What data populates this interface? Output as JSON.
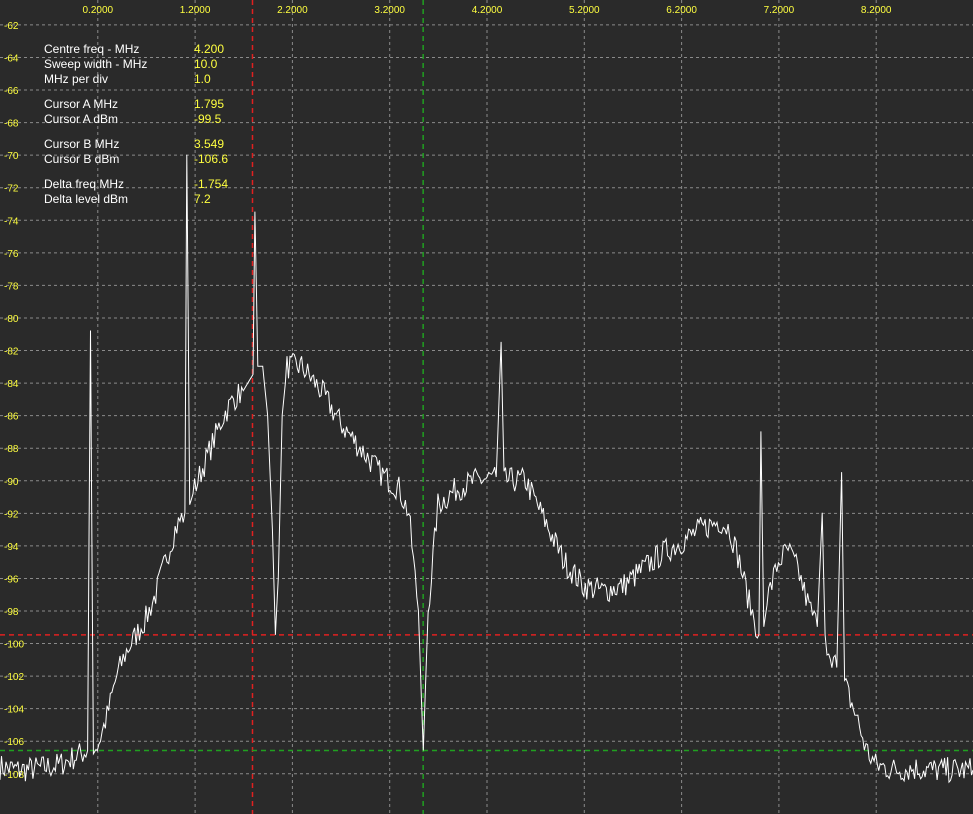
{
  "chart_data": {
    "type": "line",
    "title": "",
    "xlabel": "",
    "ylabel": "",
    "x_tick_labels": [
      "0.2000",
      "1.2000",
      "2.2000",
      "3.2000",
      "4.2000",
      "5.2000",
      "6.2000",
      "7.2000",
      "8.2000"
    ],
    "x_ticks": [
      0.2,
      1.2,
      2.2,
      3.2,
      4.2,
      5.2,
      6.2,
      7.2,
      8.2
    ],
    "xlim": [
      -0.8,
      9.2
    ],
    "y_tick_labels": [
      "-62",
      "-64",
      "-66",
      "-68",
      "-70",
      "-72",
      "-74",
      "-76",
      "-78",
      "-80",
      "-82",
      "-84",
      "-86",
      "-88",
      "-90",
      "-92",
      "-94",
      "-96",
      "-98",
      "-100",
      "-102",
      "-104",
      "-106",
      "-108"
    ],
    "y_ticks": [
      -62,
      -64,
      -66,
      -68,
      -70,
      -72,
      -74,
      -76,
      -78,
      -80,
      -82,
      -84,
      -86,
      -88,
      -90,
      -92,
      -94,
      -96,
      -98,
      -100,
      -102,
      -104,
      -106,
      -108
    ],
    "ylim": [
      -110.5,
      -60.5
    ],
    "grid": true,
    "colors": {
      "background": "#2a2a2a",
      "grid": "#8a8a8a",
      "trace": "#ffffff",
      "labels": "#ffff40",
      "cursor_a": "#e02020",
      "cursor_b": "#20a020"
    },
    "cursors": {
      "a": {
        "freq": 1.795,
        "level": -99.5
      },
      "b": {
        "freq": 3.549,
        "level": -106.6
      }
    },
    "series": [
      {
        "values": [
          [
            -0.8,
            -107.6
          ],
          [
            -0.6,
            -107.8
          ],
          [
            -0.4,
            -107.7
          ],
          [
            -0.2,
            -107.5
          ],
          [
            0.0,
            -106.9
          ],
          [
            0.1,
            -106.6
          ],
          [
            0.13,
            -80.8
          ],
          [
            0.16,
            -106.8
          ],
          [
            0.2,
            -106.4
          ],
          [
            0.3,
            -104.5
          ],
          [
            0.4,
            -102.0
          ],
          [
            0.5,
            -100.5
          ],
          [
            0.6,
            -99.5
          ],
          [
            0.7,
            -98.5
          ],
          [
            0.8,
            -97.0
          ],
          [
            0.9,
            -95.0
          ],
          [
            1.0,
            -93.0
          ],
          [
            1.1,
            -92.0
          ],
          [
            1.12,
            -70.0
          ],
          [
            1.15,
            -91.5
          ],
          [
            1.2,
            -90.5
          ],
          [
            1.3,
            -89.0
          ],
          [
            1.4,
            -87.5
          ],
          [
            1.5,
            -86.0
          ],
          [
            1.6,
            -85.0
          ],
          [
            1.7,
            -84.5
          ],
          [
            1.75,
            -84.0
          ],
          [
            1.8,
            -83.5
          ],
          [
            1.82,
            -73.5
          ],
          [
            1.85,
            -83.0
          ],
          [
            1.9,
            -83.0
          ],
          [
            1.95,
            -86.0
          ],
          [
            2.0,
            -93.0
          ],
          [
            2.03,
            -99.5
          ],
          [
            2.06,
            -96.0
          ],
          [
            2.1,
            -86.0
          ],
          [
            2.15,
            -83.0
          ],
          [
            2.3,
            -83.0
          ],
          [
            2.5,
            -84.5
          ],
          [
            2.7,
            -86.5
          ],
          [
            2.9,
            -88.0
          ],
          [
            3.1,
            -89.5
          ],
          [
            3.3,
            -90.5
          ],
          [
            3.4,
            -92.0
          ],
          [
            3.5,
            -98.0
          ],
          [
            3.55,
            -106.6
          ],
          [
            3.6,
            -98.0
          ],
          [
            3.7,
            -91.5
          ],
          [
            3.9,
            -90.5
          ],
          [
            4.1,
            -90.0
          ],
          [
            4.3,
            -89.8
          ],
          [
            4.35,
            -81.5
          ],
          [
            4.38,
            -90.0
          ],
          [
            4.6,
            -90.0
          ],
          [
            4.8,
            -92.5
          ],
          [
            5.0,
            -95.0
          ],
          [
            5.2,
            -96.5
          ],
          [
            5.4,
            -96.8
          ],
          [
            5.6,
            -96.5
          ],
          [
            5.8,
            -95.5
          ],
          [
            6.0,
            -94.5
          ],
          [
            6.2,
            -93.8
          ],
          [
            6.4,
            -93.0
          ],
          [
            6.6,
            -92.5
          ],
          [
            6.7,
            -93.0
          ],
          [
            6.8,
            -95.0
          ],
          [
            6.9,
            -97.5
          ],
          [
            7.0,
            -99.5
          ],
          [
            7.02,
            -87.0
          ],
          [
            7.05,
            -99.0
          ],
          [
            7.1,
            -97.0
          ],
          [
            7.2,
            -95.0
          ],
          [
            7.3,
            -94.3
          ],
          [
            7.4,
            -95.5
          ],
          [
            7.5,
            -97.5
          ],
          [
            7.6,
            -99.0
          ],
          [
            7.65,
            -92.0
          ],
          [
            7.68,
            -99.5
          ],
          [
            7.7,
            -100.0
          ],
          [
            7.8,
            -101.5
          ],
          [
            7.85,
            -89.5
          ],
          [
            7.88,
            -102.5
          ],
          [
            8.0,
            -104.5
          ],
          [
            8.1,
            -106.5
          ],
          [
            8.2,
            -107.5
          ],
          [
            8.4,
            -107.8
          ],
          [
            8.6,
            -107.7
          ],
          [
            8.8,
            -107.8
          ],
          [
            9.2,
            -107.8
          ]
        ]
      }
    ]
  },
  "readout": {
    "centre_freq_label": "Centre freq - MHz",
    "centre_freq_value": "4.200",
    "sweep_width_label": "Sweep width - MHz",
    "sweep_width_value": "10.0",
    "mhz_per_div_label": "MHz per div",
    "mhz_per_div_value": "1.0",
    "cursor_a_mhz_label": "Cursor A MHz",
    "cursor_a_mhz_value": "1.795",
    "cursor_a_dbm_label": "Cursor A dBm",
    "cursor_a_dbm_value": "-99.5",
    "cursor_b_mhz_label": "Cursor B MHz",
    "cursor_b_mhz_value": "3.549",
    "cursor_b_dbm_label": "Cursor B dBm",
    "cursor_b_dbm_value": "-106.6",
    "delta_freq_label": "Delta freq MHz",
    "delta_freq_value": "-1.754",
    "delta_level_label": "Delta level dBm",
    "delta_level_value": "7.2"
  }
}
